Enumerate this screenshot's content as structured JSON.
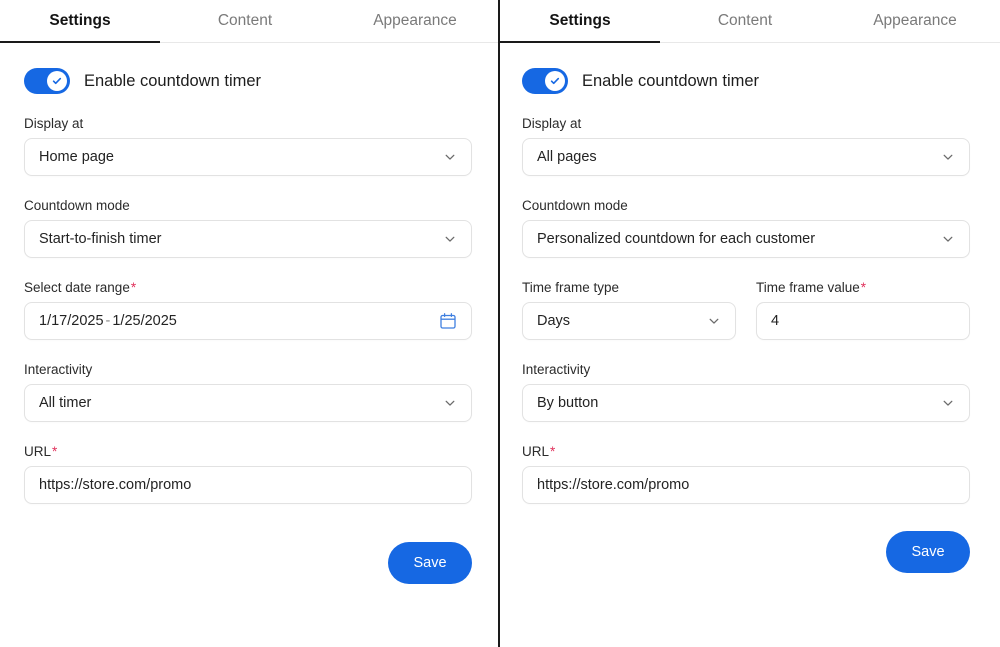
{
  "panels": [
    {
      "id": "left",
      "tabs": [
        {
          "label": "Settings",
          "active": true
        },
        {
          "label": "Content",
          "active": false
        },
        {
          "label": "Appearance",
          "active": false
        }
      ],
      "toggle": {
        "label": "Enable countdown timer",
        "state": "on",
        "icon": "check-icon",
        "color": "#1668e3"
      },
      "fields": {
        "display_at": {
          "label": "Display at",
          "value": "Home page",
          "icon": "chevron-down-icon"
        },
        "countdown_mode": {
          "label": "Countdown mode",
          "value": "Start-to-finish timer",
          "icon": "chevron-down-icon"
        },
        "date_range": {
          "label": "Select date range",
          "required": "*",
          "start": "1/17/2025",
          "separator": "-",
          "end": "1/25/2025",
          "icon": "calendar-icon",
          "icon_color": "#3f7fe0"
        },
        "interactivity": {
          "label": "Interactivity",
          "value": "All timer",
          "icon": "chevron-down-icon"
        },
        "url": {
          "label": "URL",
          "required": "*",
          "value": "https://store.com/promo",
          "placeholder": "https://store.com/promo"
        }
      },
      "save_label": "Save"
    },
    {
      "id": "right",
      "tabs": [
        {
          "label": "Settings",
          "active": true
        },
        {
          "label": "Content",
          "active": false
        },
        {
          "label": "Appearance",
          "active": false
        }
      ],
      "toggle": {
        "label": "Enable countdown timer",
        "state": "on",
        "icon": "check-icon",
        "color": "#1668e3"
      },
      "fields": {
        "display_at": {
          "label": "Display at",
          "value": "All pages",
          "icon": "chevron-down-icon"
        },
        "countdown_mode": {
          "label": "Countdown mode",
          "value": "Personalized countdown for each customer",
          "icon": "chevron-down-icon"
        },
        "time_frame_type": {
          "label": "Time frame type",
          "value": "Days",
          "icon": "chevron-down-icon"
        },
        "time_frame_value": {
          "label": "Time frame value",
          "required": "*",
          "value": "4",
          "placeholder": "4"
        },
        "interactivity": {
          "label": "Interactivity",
          "value": "By button",
          "icon": "chevron-down-icon"
        },
        "url": {
          "label": "URL",
          "required": "*",
          "value": "https://store.com/promo",
          "placeholder": "https://store.com/promo"
        }
      },
      "save_label": "Save"
    }
  ],
  "colors": {
    "accent": "#1668e3",
    "required": "#e0315b",
    "active_tab_underline": "#1a1a1a",
    "border": "#e2e2e2",
    "divider": "#1a1a1a"
  }
}
